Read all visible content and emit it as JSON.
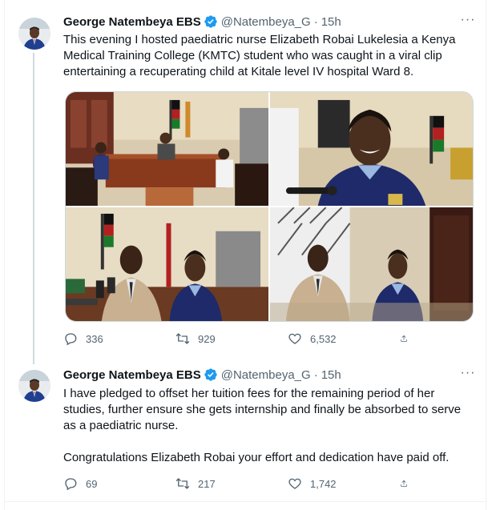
{
  "colors": {
    "accent": "#1d9bf0",
    "text": "#0f1419",
    "muted": "#536471",
    "border": "#eff3f4"
  },
  "tweets": [
    {
      "author": {
        "name": "George Natembeya EBS",
        "handle": "@Natembeya_G",
        "verified": true,
        "avatar_icon": "avatar"
      },
      "separator": "·",
      "time": "15h",
      "more_icon": "more-icon",
      "text_lines": [
        "This evening I hosted paediatric nurse Elizabeth Robai Lukelesia a Kenya Medical Training College (KMTC) student who was caught in a viral clip entertaining a recuperating child at Kitale level IV hospital Ward 8."
      ],
      "media": [
        "photo-office-meeting",
        "photo-student-smiling",
        "photo-interview",
        "photo-standing-pair"
      ],
      "stats": {
        "replies": "336",
        "retweets": "929",
        "likes": "6,532"
      }
    },
    {
      "author": {
        "name": "George Natembeya EBS",
        "handle": "@Natembeya_G",
        "verified": true,
        "avatar_icon": "avatar"
      },
      "separator": "·",
      "time": "15h",
      "more_icon": "more-icon",
      "text_lines": [
        "I have pledged to offset  her tuition fees for the remaining period of her studies, further ensure she gets internship and finally be absorbed to serve as a paediatric nurse.",
        "Congratulations Elizabeth Robai your effort and dedication have paid off."
      ],
      "stats": {
        "replies": "69",
        "retweets": "217",
        "likes": "1,742"
      }
    }
  ]
}
